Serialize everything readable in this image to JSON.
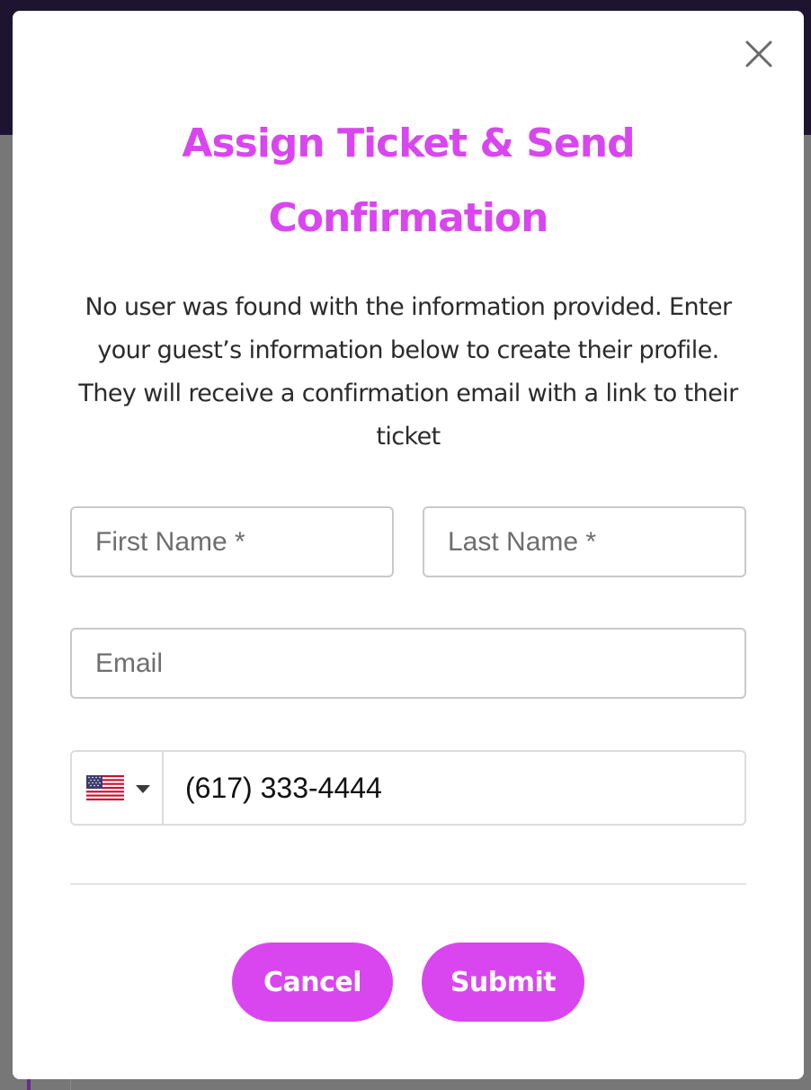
{
  "modal": {
    "title": "Assign Ticket & Send Confirmation",
    "description": "No user was found with the information provided. Enter your guest’s information below to create their profile. They will receive a confirmation email with a link to their ticket",
    "close_icon": "close-icon"
  },
  "form": {
    "first_name": {
      "placeholder": "First Name *",
      "value": ""
    },
    "last_name": {
      "placeholder": "Last Name *",
      "value": ""
    },
    "email": {
      "placeholder": "Email",
      "value": ""
    },
    "phone": {
      "country": "US",
      "flag_icon": "us-flag-icon",
      "value": "(617) 333-4444"
    }
  },
  "buttons": {
    "cancel_label": "Cancel",
    "submit_label": "Submit"
  },
  "colors": {
    "accent": "#d946ef",
    "text": "#2b2b2b",
    "field_border": "#c9c9c9",
    "backdrop": "#777777"
  }
}
